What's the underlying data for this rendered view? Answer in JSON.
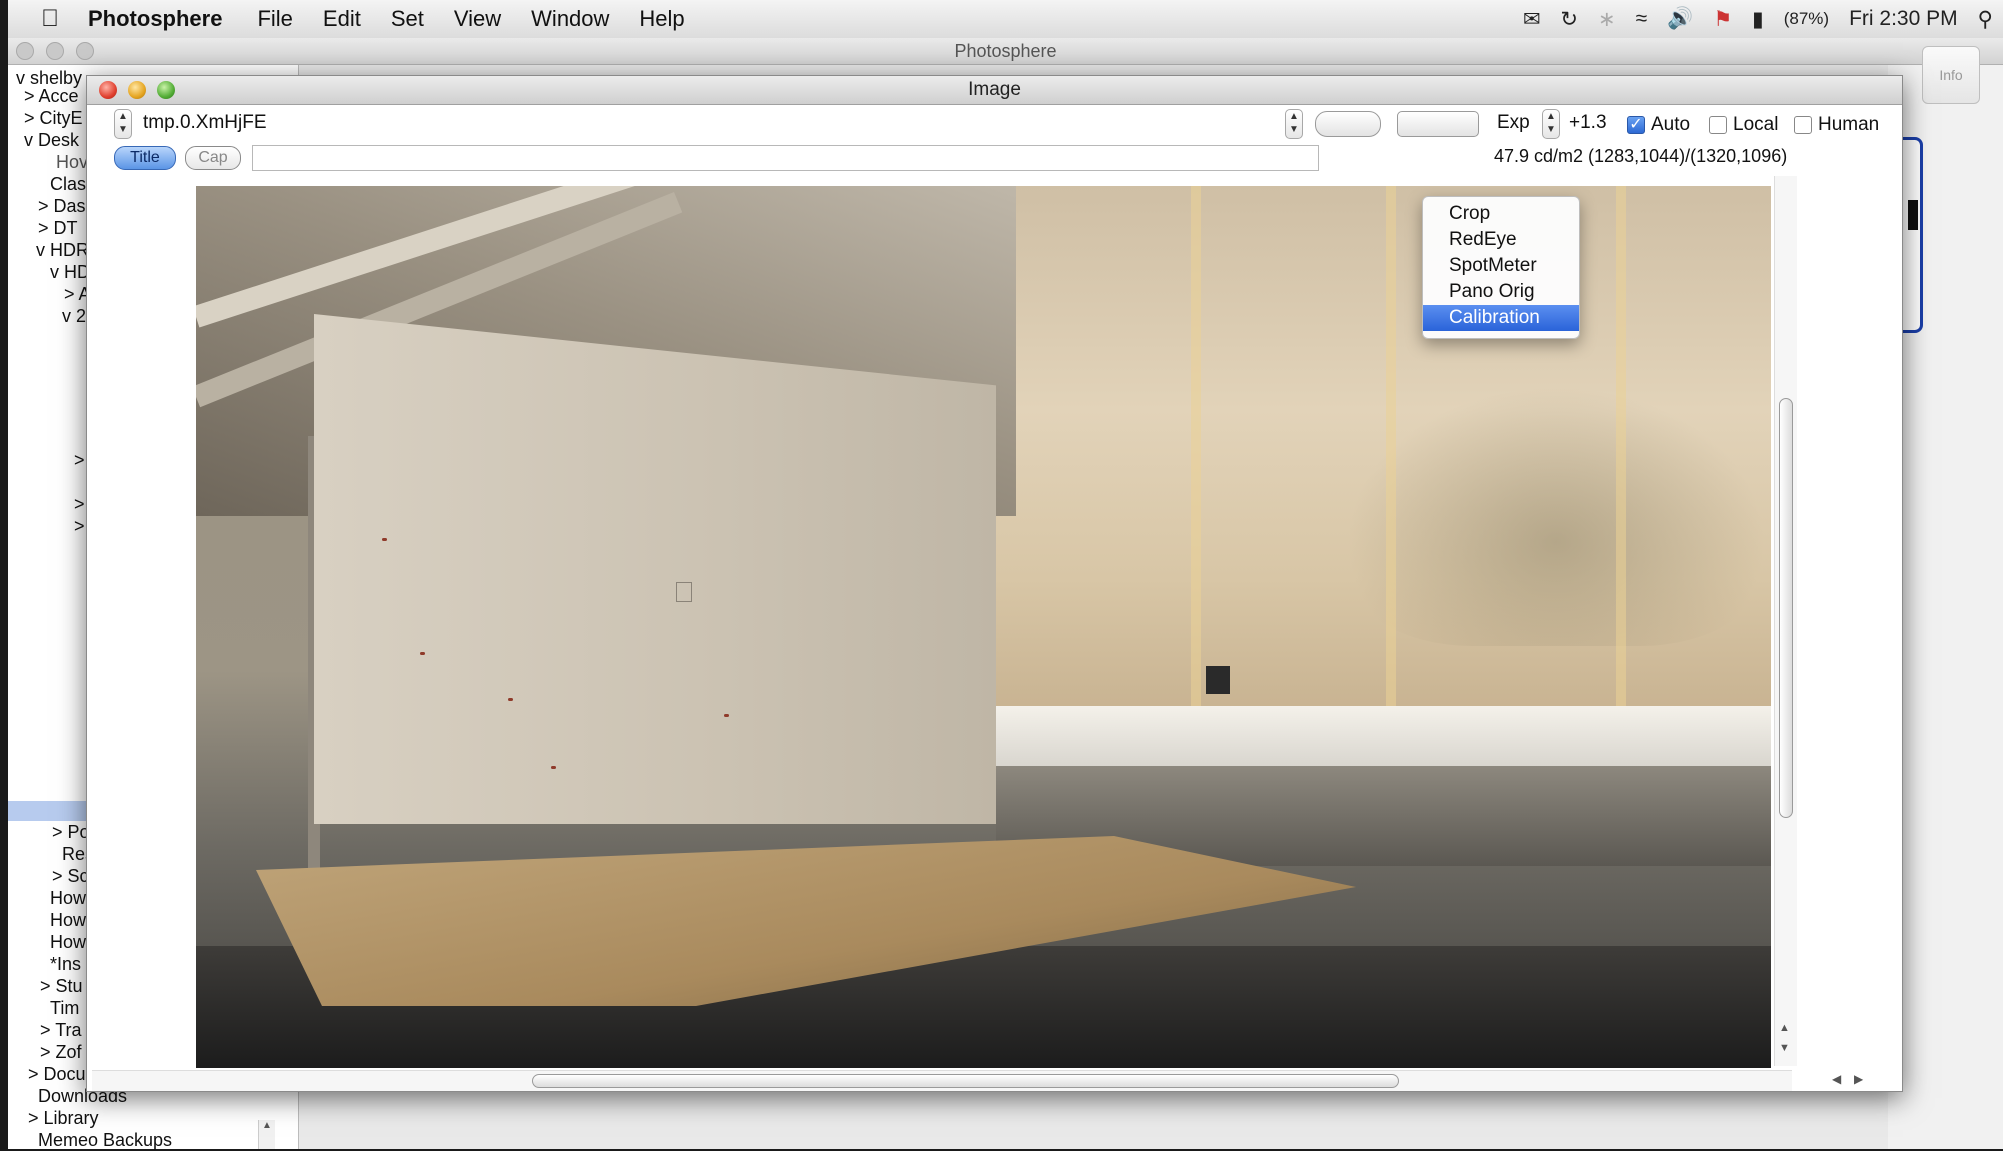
{
  "menubar": {
    "app_name": "Photosphere",
    "menus": [
      "File",
      "Edit",
      "Set",
      "View",
      "Window",
      "Help"
    ],
    "battery": "(87%)",
    "clock": "Fri 2:30 PM"
  },
  "main_window": {
    "title": "Photosphere",
    "info_button": "Info"
  },
  "sidebar": {
    "rows": [
      "v shelby",
      "> Acce",
      "> CityE",
      "v Desk",
      "Hov",
      "Clas",
      "> Das",
      "> DT",
      "v HDR",
      "v HD",
      "> A",
      "v 2",
      ">",
      ">",
      ">",
      "> Po",
      "Res",
      "> Sc",
      "How",
      "How",
      "How",
      "*Ins",
      "> Stu",
      "Tim",
      "> Tra",
      "> Zof",
      "> Docu",
      "Downloads",
      "> Library",
      "Memeo Backups"
    ]
  },
  "image_window": {
    "title": "Image",
    "filename": "tmp.0.XmHjFE",
    "exposure_label": "Exp",
    "exposure_value": "+1.3",
    "auto_label": "Auto",
    "local_label": "Local",
    "human_label": "Human",
    "title_button": "Title",
    "cap_button": "Cap",
    "caption_value": "",
    "readout": "47.9 cd/m2 (1283,1044)/(1320,1096)"
  },
  "dropdown": {
    "items": [
      "Crop",
      "RedEye",
      "SpotMeter",
      "Pano Orig",
      "Calibration"
    ],
    "selected": "Calibration"
  }
}
